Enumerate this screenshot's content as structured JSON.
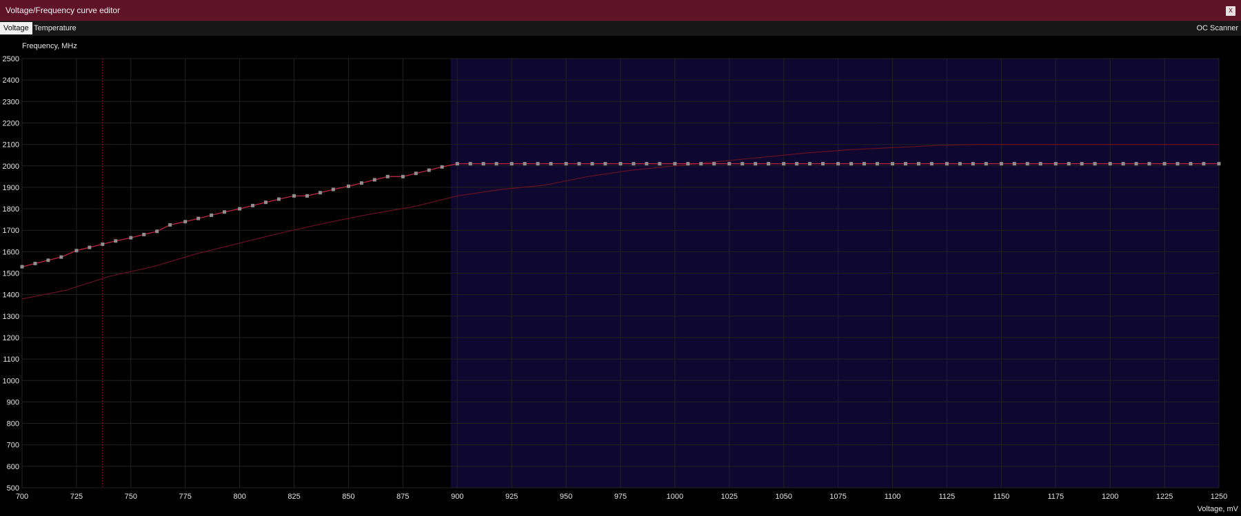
{
  "window": {
    "title": "Voltage/Frequency curve editor",
    "close_label": "x"
  },
  "tabs": [
    {
      "label": "Voltage",
      "active": true
    },
    {
      "label": "Temperature",
      "active": false
    }
  ],
  "oc_scanner_label": "OC Scanner",
  "colors": {
    "title_bar": "#5e1326",
    "plot_bg": "#000000",
    "highlight_region": "#0e0830",
    "curve": "#c0243c",
    "baseline_curve": "#6a1020",
    "point": "#8f8f8f",
    "grid": "#222222",
    "cursor_line": "#7a1020"
  },
  "chart_data": {
    "type": "line",
    "ylabel": "Frequency, MHz",
    "xlabel": "Voltage, mV",
    "xlim": [
      700,
      1250
    ],
    "ylim": [
      500,
      2500
    ],
    "xticks": [
      700,
      725,
      750,
      775,
      800,
      825,
      850,
      875,
      900,
      925,
      950,
      975,
      1000,
      1025,
      1050,
      1075,
      1100,
      1125,
      1150,
      1175,
      1200,
      1225,
      1250
    ],
    "yticks": [
      500,
      600,
      700,
      800,
      900,
      1000,
      1100,
      1200,
      1300,
      1400,
      1500,
      1600,
      1700,
      1800,
      1900,
      2000,
      2100,
      2200,
      2300,
      2400,
      2500
    ],
    "grid": true,
    "highlight_region": {
      "x_from": 897,
      "x_to": 1250
    },
    "cursor_x": 737,
    "series": [
      {
        "role": "edited-curve",
        "points": [
          [
            700,
            1530
          ],
          [
            706,
            1545
          ],
          [
            712,
            1560
          ],
          [
            718,
            1575
          ],
          [
            725,
            1605
          ],
          [
            731,
            1620
          ],
          [
            737,
            1635
          ],
          [
            743,
            1650
          ],
          [
            750,
            1665
          ],
          [
            756,
            1680
          ],
          [
            762,
            1695
          ],
          [
            768,
            1725
          ],
          [
            775,
            1740
          ],
          [
            781,
            1755
          ],
          [
            787,
            1770
          ],
          [
            793,
            1785
          ],
          [
            800,
            1800
          ],
          [
            806,
            1815
          ],
          [
            812,
            1830
          ],
          [
            818,
            1845
          ],
          [
            825,
            1860
          ],
          [
            831,
            1860
          ],
          [
            837,
            1875
          ],
          [
            843,
            1890
          ],
          [
            850,
            1905
          ],
          [
            856,
            1920
          ],
          [
            862,
            1935
          ],
          [
            868,
            1950
          ],
          [
            875,
            1950
          ],
          [
            881,
            1965
          ],
          [
            887,
            1980
          ],
          [
            893,
            1995
          ],
          [
            900,
            2010
          ],
          [
            906,
            2010
          ],
          [
            912,
            2010
          ],
          [
            918,
            2010
          ],
          [
            925,
            2010
          ],
          [
            931,
            2010
          ],
          [
            937,
            2010
          ],
          [
            943,
            2010
          ],
          [
            950,
            2010
          ],
          [
            956,
            2010
          ],
          [
            962,
            2010
          ],
          [
            968,
            2010
          ],
          [
            975,
            2010
          ],
          [
            981,
            2010
          ],
          [
            987,
            2010
          ],
          [
            993,
            2010
          ],
          [
            1000,
            2010
          ],
          [
            1006,
            2010
          ],
          [
            1012,
            2010
          ],
          [
            1018,
            2010
          ],
          [
            1025,
            2010
          ],
          [
            1031,
            2010
          ],
          [
            1037,
            2010
          ],
          [
            1043,
            2010
          ],
          [
            1050,
            2010
          ],
          [
            1056,
            2010
          ],
          [
            1062,
            2010
          ],
          [
            1068,
            2010
          ],
          [
            1075,
            2010
          ],
          [
            1081,
            2010
          ],
          [
            1087,
            2010
          ],
          [
            1093,
            2010
          ],
          [
            1100,
            2010
          ],
          [
            1106,
            2010
          ],
          [
            1112,
            2010
          ],
          [
            1118,
            2010
          ],
          [
            1125,
            2010
          ],
          [
            1131,
            2010
          ],
          [
            1137,
            2010
          ],
          [
            1143,
            2010
          ],
          [
            1150,
            2010
          ],
          [
            1156,
            2010
          ],
          [
            1162,
            2010
          ],
          [
            1168,
            2010
          ],
          [
            1175,
            2010
          ],
          [
            1181,
            2010
          ],
          [
            1187,
            2010
          ],
          [
            1193,
            2010
          ],
          [
            1200,
            2010
          ],
          [
            1206,
            2010
          ],
          [
            1212,
            2010
          ],
          [
            1218,
            2010
          ],
          [
            1225,
            2010
          ],
          [
            1231,
            2010
          ],
          [
            1237,
            2010
          ],
          [
            1243,
            2010
          ],
          [
            1250,
            2010
          ]
        ]
      },
      {
        "role": "default-curve",
        "points": [
          [
            700,
            1380
          ],
          [
            720,
            1420
          ],
          [
            740,
            1485
          ],
          [
            760,
            1530
          ],
          [
            780,
            1590
          ],
          [
            800,
            1640
          ],
          [
            820,
            1690
          ],
          [
            840,
            1735
          ],
          [
            860,
            1775
          ],
          [
            880,
            1810
          ],
          [
            900,
            1860
          ],
          [
            920,
            1890
          ],
          [
            940,
            1910
          ],
          [
            960,
            1950
          ],
          [
            980,
            1980
          ],
          [
            1000,
            2000
          ],
          [
            1020,
            2020
          ],
          [
            1040,
            2040
          ],
          [
            1060,
            2060
          ],
          [
            1080,
            2075
          ],
          [
            1100,
            2085
          ],
          [
            1120,
            2095
          ],
          [
            1140,
            2100
          ],
          [
            1160,
            2100
          ],
          [
            1180,
            2100
          ],
          [
            1200,
            2100
          ],
          [
            1220,
            2100
          ],
          [
            1250,
            2100
          ]
        ]
      }
    ]
  }
}
